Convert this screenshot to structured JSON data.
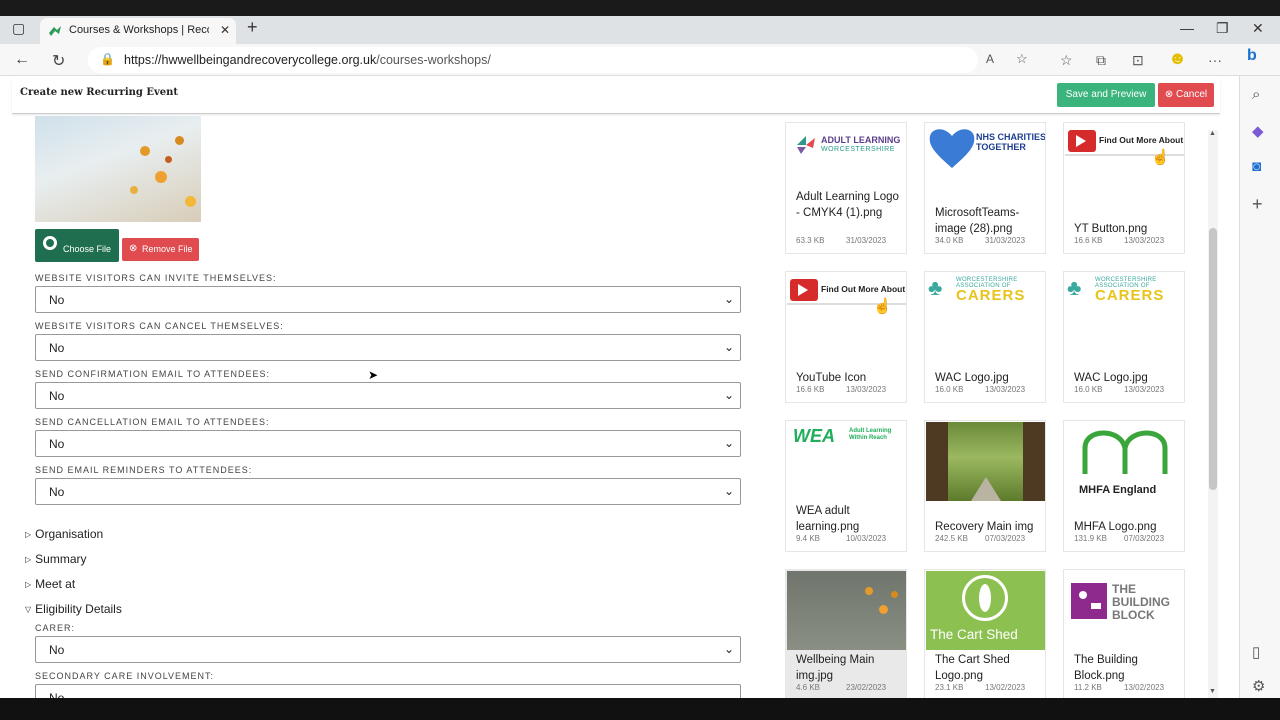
{
  "browser": {
    "tab_title": "Courses & Workshops | Recovery",
    "url_host": "https://hwwellbeingandrecoverycollege.org.uk",
    "url_path": "/courses-workshops/"
  },
  "modal": {
    "title": "Create new Recurring Event",
    "save_label": "Save and Preview",
    "cancel_label": "Cancel"
  },
  "file_buttons": {
    "choose_label": "Choose File",
    "remove_label": "Remove File"
  },
  "fields": [
    {
      "label": "WEBSITE VISITORS CAN INVITE THEMSELVES:",
      "value": "No"
    },
    {
      "label": "WEBSITE VISITORS CAN CANCEL THEMSELVES:",
      "value": "No"
    },
    {
      "label": "SEND CONFIRMATION EMAIL TO ATTENDEES:",
      "value": "No"
    },
    {
      "label": "SEND CANCELLATION EMAIL TO ATTENDEES:",
      "value": "No"
    },
    {
      "label": "SEND EMAIL REMINDERS TO ATTENDEES:",
      "value": "No"
    }
  ],
  "sections": [
    "Organisation",
    "Summary",
    "Meet at",
    "Eligibility Details"
  ],
  "eligibility_fields": [
    {
      "label": "CARER:",
      "value": "No"
    },
    {
      "label": "SECONDARY CARE INVOLVEMENT:",
      "value": "No"
    }
  ],
  "media": [
    {
      "name": "Adult Learning Logo - CMYK4 (1).png",
      "size": "63.3 KB",
      "date": "31/03/2023",
      "thumb_text": "ADULT LEARNING",
      "thumb_sub": "WORCESTERSHIRE"
    },
    {
      "name": "MicrosoftTeams-image (28).png",
      "size": "34.0 KB",
      "date": "31/03/2023",
      "thumb_text": "NHS CHARITIES TOGETHER"
    },
    {
      "name": "YT Button.png",
      "size": "16.6 KB",
      "date": "13/03/2023",
      "thumb_text": "Find Out More About"
    },
    {
      "name": "YouTube Icon",
      "size": "16.6 KB",
      "date": "13/03/2023",
      "thumb_text": "Find Out More About"
    },
    {
      "name": "WAC Logo.jpg",
      "size": "16.0 KB",
      "date": "13/03/2023",
      "thumb_text": "CARERS",
      "thumb_sub": "WORCESTERSHIRE ASSOCIATION OF"
    },
    {
      "name": "WAC Logo.jpg",
      "size": "16.0 KB",
      "date": "13/03/2023",
      "thumb_text": "CARERS",
      "thumb_sub": "WORCESTERSHIRE ASSOCIATION OF"
    },
    {
      "name": "WEA adult learning.png",
      "size": "9.4 KB",
      "date": "10/03/2023",
      "thumb_text": "WEA",
      "thumb_sub": "Adult Learning Within Reach"
    },
    {
      "name": "Recovery Main img",
      "size": "242.5 KB",
      "date": "07/03/2023"
    },
    {
      "name": "MHFA Logo.png",
      "size": "131.9 KB",
      "date": "07/03/2023",
      "thumb_text": "MHFA England"
    },
    {
      "name": "Wellbeing Main img.jpg",
      "size": "4.6 KB",
      "date": "23/02/2023"
    },
    {
      "name": "The Cart Shed Logo.png",
      "size": "23.1 KB",
      "date": "13/02/2023",
      "thumb_text": "The Cart Shed"
    },
    {
      "name": "The Building Block.png",
      "size": "11.2 KB",
      "date": "13/02/2023",
      "thumb_text": "THE BUILDING BLOCK"
    }
  ],
  "colors": {
    "save": "#3ab37c",
    "cancel": "#e04b50",
    "choose": "#1f6e4f"
  }
}
